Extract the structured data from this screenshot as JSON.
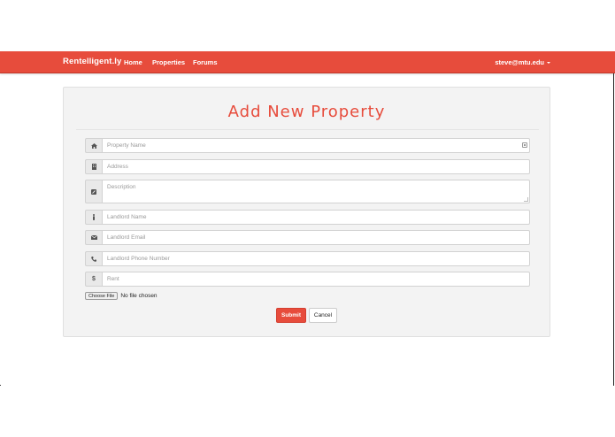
{
  "navbar": {
    "brand": "Rentelligent.ly",
    "links": [
      {
        "label": "Home"
      },
      {
        "label": "Properties"
      },
      {
        "label": "Forums"
      }
    ],
    "user_email": "steve@mtu.edu",
    "color": "#e74c3c"
  },
  "form": {
    "title": "Add New Property",
    "fields": [
      {
        "placeholder": "Property Name",
        "icon": "home-icon"
      },
      {
        "placeholder": "Address",
        "icon": "building-icon"
      },
      {
        "placeholder": "Description",
        "icon": "edit-icon"
      },
      {
        "placeholder": "Landlord Name",
        "icon": "person-icon"
      },
      {
        "placeholder": "Landlord Email",
        "icon": "envelope-icon"
      },
      {
        "placeholder": "Landlord Phone Number",
        "icon": "phone-icon"
      },
      {
        "placeholder": "Rent",
        "icon": "dollar-icon"
      }
    ],
    "file": {
      "button_label": "Choose File",
      "status": "No file chosen"
    },
    "submit_label": "Submit",
    "cancel_label": "Cancel"
  }
}
